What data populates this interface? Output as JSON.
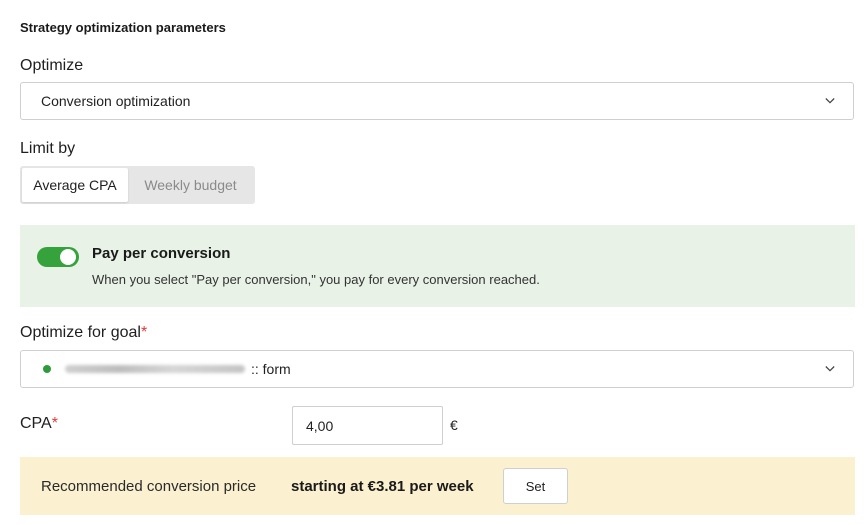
{
  "section_title": "Strategy optimization parameters",
  "optimize": {
    "label": "Optimize",
    "selected": "Conversion optimization",
    "icon": "chevron-down-icon"
  },
  "limit_by": {
    "label": "Limit by",
    "options": [
      "Average CPA",
      "Weekly budget"
    ],
    "active": "Average CPA"
  },
  "pay_per_conversion": {
    "enabled": true,
    "title": "Pay per conversion",
    "description": "When you select \"Pay per conversion,\" you pay for every conversion reached.",
    "accent_color": "#35a23b",
    "background_color": "#e8f2e6"
  },
  "goal": {
    "label": "Optimize for goal",
    "required_mark": "*",
    "selected_suffix": ":: form",
    "status_color": "#2e9b3a"
  },
  "cpa": {
    "label": "CPA",
    "required_mark": "*",
    "value": "4,00",
    "currency": "€"
  },
  "recommendation": {
    "text": "Recommended conversion price",
    "value": "starting at €3.81 per week",
    "button": "Set",
    "background_color": "#fbf0cf"
  }
}
